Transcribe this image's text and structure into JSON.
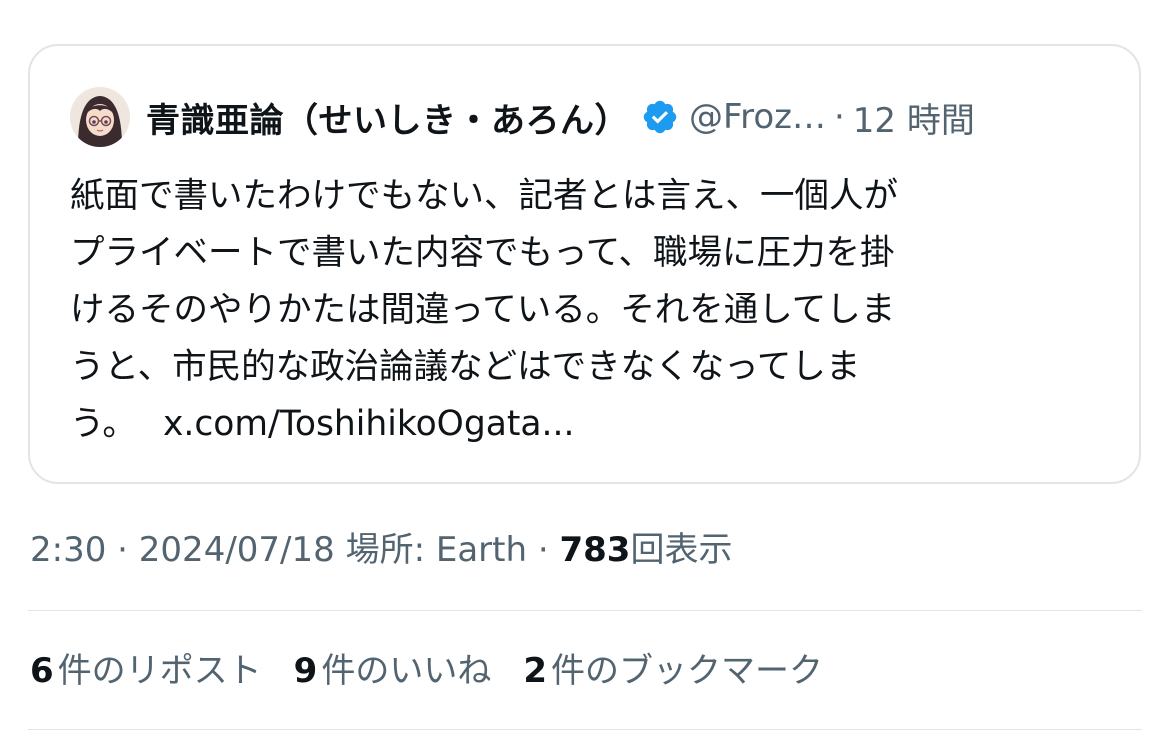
{
  "quoted_tweet": {
    "author": {
      "display_name": "青識亜論（せいしき・あろん）",
      "handle": "@Froz…",
      "separator": "·",
      "time_ago": "12 時間"
    },
    "text_lines": [
      "紙面で書いたわけでもない、記者とは言え、一個人が",
      "プライベートで書いた内容でもって、職場に圧力を掛",
      "けるそのやりかたは間違っている。それを通してしま",
      "うと、市民的な政治論議などはできなくなってしま",
      "う。"
    ],
    "link_text": "x.com/ToshihikoOgata..."
  },
  "meta": {
    "time": "2:30",
    "sep1": "·",
    "date": "2024/07/18",
    "location": "場所: Earth",
    "sep2": "·",
    "views_count": "783",
    "views_label": "回表示"
  },
  "stats": {
    "reposts_count": "6",
    "reposts_label": "件のリポスト",
    "likes_count": "9",
    "likes_label": "件のいいね",
    "bookmarks_count": "2",
    "bookmarks_label": "件のブックマーク"
  },
  "colors": {
    "text_primary": "#0f1419",
    "text_secondary": "#536471",
    "verified_blue": "#1d9bf0",
    "border": "#e1e5e9"
  },
  "icons": [
    "avatar",
    "verified-badge-icon"
  ]
}
